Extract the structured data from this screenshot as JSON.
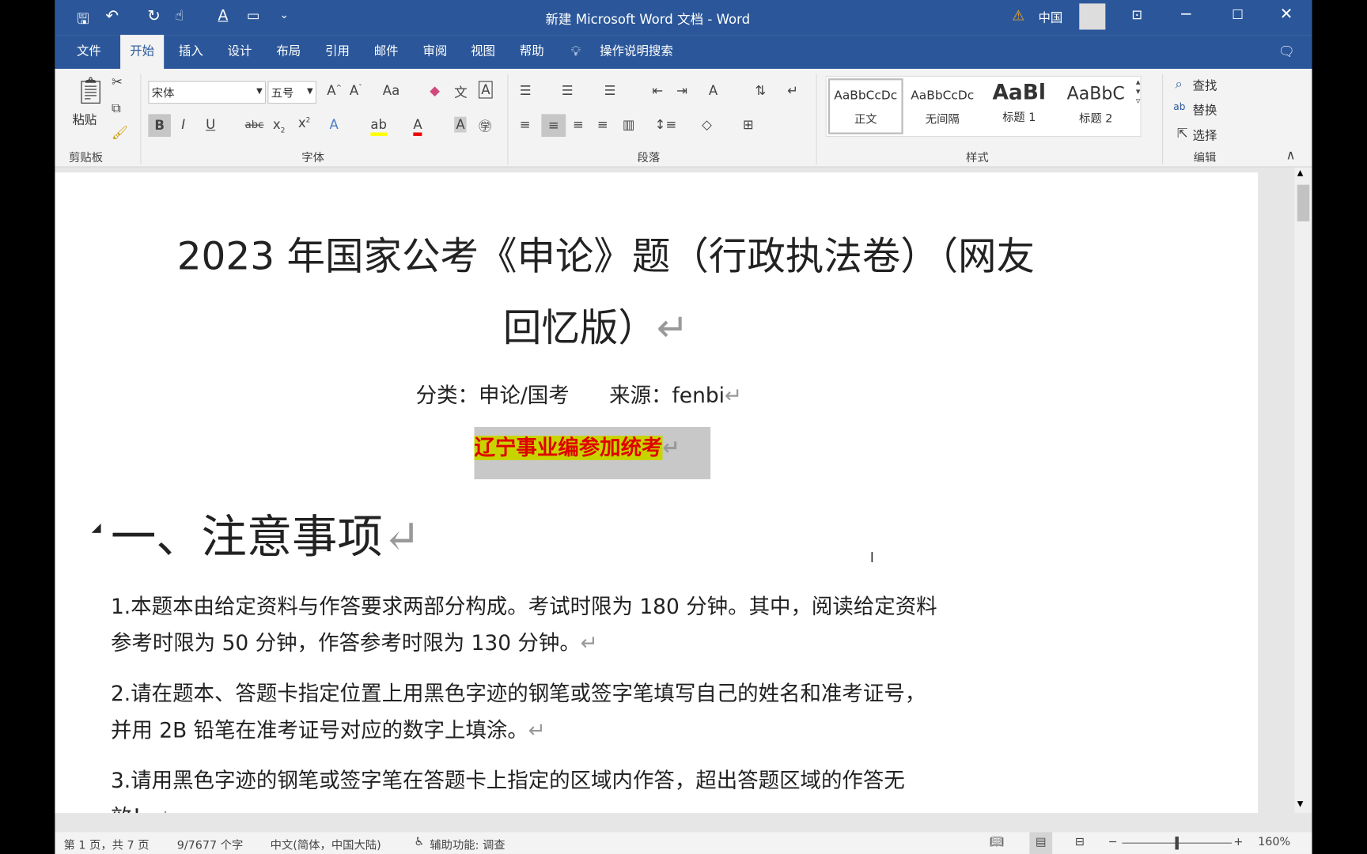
{
  "window": {
    "title": "新建 Microsoft Word 文档  -  Word",
    "account": "中国",
    "colors": {
      "accent": "#2b579a",
      "highlight": "#c8d400",
      "red_text": "#e00000"
    }
  },
  "qat": {
    "icons": [
      "save-icon",
      "undo-icon",
      "redo-icon",
      "touch-mode-icon",
      "font-color-icon",
      "comment-icon",
      "customize-icon"
    ]
  },
  "tabs": [
    "文件",
    "开始",
    "插入",
    "设计",
    "布局",
    "引用",
    "邮件",
    "审阅",
    "视图",
    "帮助"
  ],
  "tell_me": "操作说明搜索",
  "ribbon": {
    "clipboard": {
      "paste": "粘贴",
      "label": "剪贴板"
    },
    "font": {
      "name": "宋体",
      "size": "五号",
      "label": "字体",
      "aa": "Aa"
    },
    "paragraph": {
      "label": "段落"
    },
    "styles": {
      "label": "样式",
      "items": [
        {
          "preview": "AaBbCcDc",
          "name": "正文"
        },
        {
          "preview": "AaBbCcDc",
          "name": "无间隔"
        },
        {
          "preview": "AaBl",
          "name": "标题 1"
        },
        {
          "preview": "AaBbC",
          "name": "标题 2"
        }
      ]
    },
    "editing": {
      "label": "编辑",
      "find": "查找",
      "replace": "替换",
      "select": "选择"
    }
  },
  "document": {
    "title_line1": "2023 年国家公考《申论》题（行政执法卷）（网友",
    "title_line2": "回忆版）",
    "meta": "分类：申论/国考      来源：fenbi",
    "highlight": "辽宁事业编参加统考",
    "heading": "一、注意事项",
    "para1_l1": "1.本题本由给定资料与作答要求两部分构成。考试时限为 180 分钟。其中，阅读给定资料",
    "para1_l2": "参考时限为 50 分钟，作答参考时限为 130 分钟。",
    "para2_l1": "2.请在题本、答题卡指定位置上用黑色字迹的钢笔或签字笔填写自己的姓名和准考证号，",
    "para2_l2": "并用 2B 铅笔在准考证号对应的数字上填涂。",
    "para3_l1": "3.请用黑色字迹的钢笔或签字笔在答题卡上指定的区域内作答，超出答题区域的作答无",
    "para3_l2": "效！",
    "para_mark": "↵"
  },
  "status": {
    "page": "第 1 页，共 7 页",
    "words": "9/7677 个字",
    "language": "中文(简体，中国大陆)",
    "accessibility": "辅助功能: 调查",
    "zoom": "160%",
    "zoom_level": 1.6
  }
}
